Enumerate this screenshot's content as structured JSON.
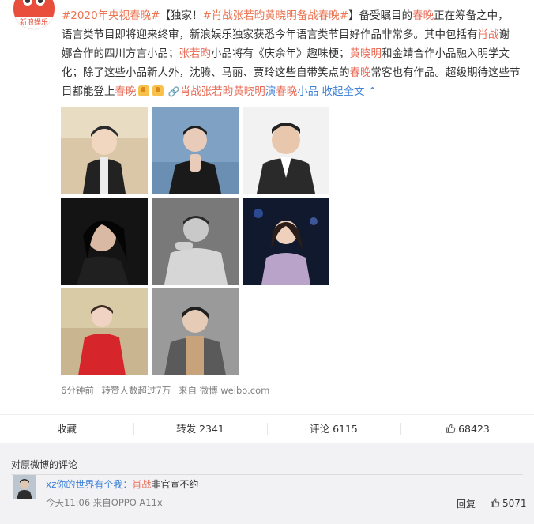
{
  "avatar": {
    "tag": "新浪娱乐"
  },
  "post": {
    "topic1": "#2020年央视",
    "topic1_hl": "春晚",
    "topic1_end": "#",
    "lead_bracket_open": "【独家！",
    "topic2_pre": "#",
    "topic2_name": "肖战",
    "topic2_name2": "张若昀",
    "topic2_name3": "黄晓明",
    "topic2_mid": "备战",
    "topic2_hl": "春晚",
    "topic2_end": "#",
    "bracket_close": "】",
    "t1": "备受瞩目的",
    "t1_hl": "春晚",
    "t2": "正在筹备之中，",
    "t3": "语言类节目即将迎来终审，新浪娱乐独家获悉今年语言类节目好作品非常多。其中包括有",
    "t3_hl": "肖战",
    "t3b": "谢",
    "t4": "娜合作的四川方言小品；",
    "t4_hl": "张若昀",
    "t5": "小品将有《庆余年》趣味梗；",
    "t5_hl": "黄晓明",
    "t6": "和金靖合作小品融入明学文化；除了这些小品新人外，沈腾、马丽、贾玲这些自带笑点的",
    "t6_hl": "春晚",
    "t7": "常客也有作品。超级期待这些节目都能登上",
    "t7_hl": "春晚",
    "link_icon": "🔗",
    "link_a": "肖战",
    "link_b": "张若昀",
    "link_c": "黄晓明",
    "link_d": "演",
    "link_e": "春晚",
    "link_f": "小品",
    "collapse": "收起全文",
    "collapse_icon": "chevron-up-icon"
  },
  "meta": {
    "time": "6分钟前",
    "reposts_note": "转赞人数超过7万",
    "source": "来自 微博 weibo.com"
  },
  "actions": {
    "favorite": "收藏",
    "repost": "转发 2341",
    "comment": "评论 6115",
    "like": "68423"
  },
  "comments": {
    "title": "对原微博的评论",
    "item": {
      "name": "xz你的世界有个我：",
      "text_hl": "肖战",
      "text": "非官宣不约",
      "time": "今天11:06 来自OPPO A11x",
      "reply": "回复",
      "likes": "5071"
    }
  },
  "colors": {
    "topic": "#eb7350",
    "link": "#3f82d6",
    "highlight": "#e96a55"
  }
}
